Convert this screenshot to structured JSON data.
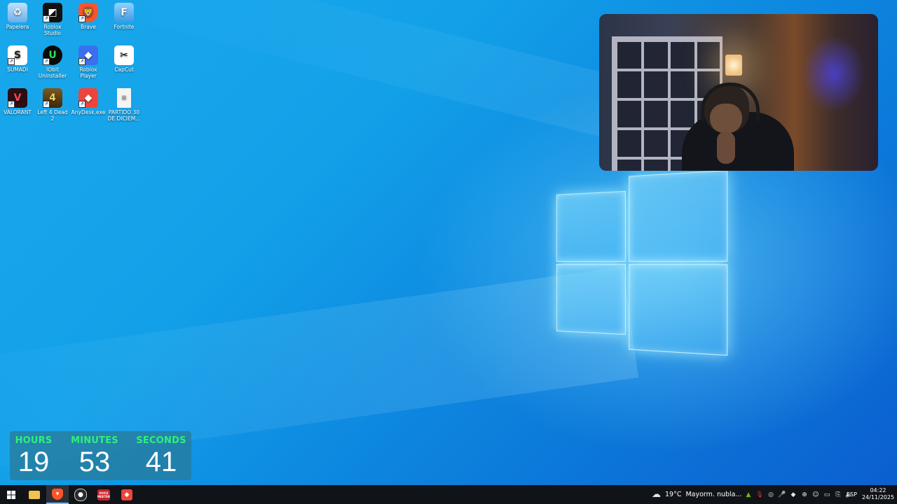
{
  "desktop": {
    "icons": [
      {
        "label": "Papelera",
        "icon": "recycle-bin-icon",
        "color": "#5aa7e0"
      },
      {
        "label": "Roblox Studio",
        "icon": "roblox-studio-icon",
        "color": "#111111"
      },
      {
        "label": "Brave",
        "icon": "brave-icon",
        "color": "#fb542b"
      },
      {
        "label": "Fortnite",
        "icon": "fortnite-icon",
        "color": "#4fb3f0"
      },
      {
        "label": "SUMADI",
        "icon": "sumadi-icon",
        "color": "#ffffff"
      },
      {
        "label": "IObit Uninstaller",
        "icon": "iobit-uninstaller-icon",
        "color": "#0a0a0a"
      },
      {
        "label": "Roblox Player",
        "icon": "roblox-player-icon",
        "color": "#3a6ff0"
      },
      {
        "label": "CapCut",
        "icon": "capcut-icon",
        "color": "#ffffff"
      },
      {
        "label": "VALORANT",
        "icon": "valorant-icon",
        "color": "#2a1014"
      },
      {
        "label": "Left 4 Dead 2",
        "icon": "left-4-dead-2-icon",
        "color": "#5a3b10"
      },
      {
        "label": "AnyDesk.exe",
        "icon": "anydesk-icon",
        "color": "#ef443b"
      },
      {
        "label": "PARTIDO 30 DE DICIEM...",
        "icon": "document-icon",
        "color": "#f0f0f0"
      }
    ]
  },
  "timer": {
    "hours_label": "HOURS",
    "minutes_label": "MINUTES",
    "seconds_label": "SECONDS",
    "hours": "19",
    "minutes": "53",
    "seconds": "41"
  },
  "taskbar": {
    "apps": [
      {
        "name": "start-button",
        "icon": "windows-start-icon",
        "active": false
      },
      {
        "name": "file-explorer",
        "icon": "folder-icon",
        "active": false
      },
      {
        "name": "brave-browser",
        "icon": "brave-icon",
        "active": true
      },
      {
        "name": "obs-studio",
        "icon": "obs-icon",
        "active": false
      },
      {
        "name": "voice-meeter",
        "icon": "voicemeeter-icon",
        "active": false,
        "text": "VOICE MEETER"
      },
      {
        "name": "anydesk",
        "icon": "anydesk-icon",
        "active": false
      }
    ],
    "weather": {
      "temp": "19°C",
      "desc": "Mayorm. nubla..."
    },
    "language": "ESP",
    "time": "04:22",
    "date": "24/11/2025"
  }
}
